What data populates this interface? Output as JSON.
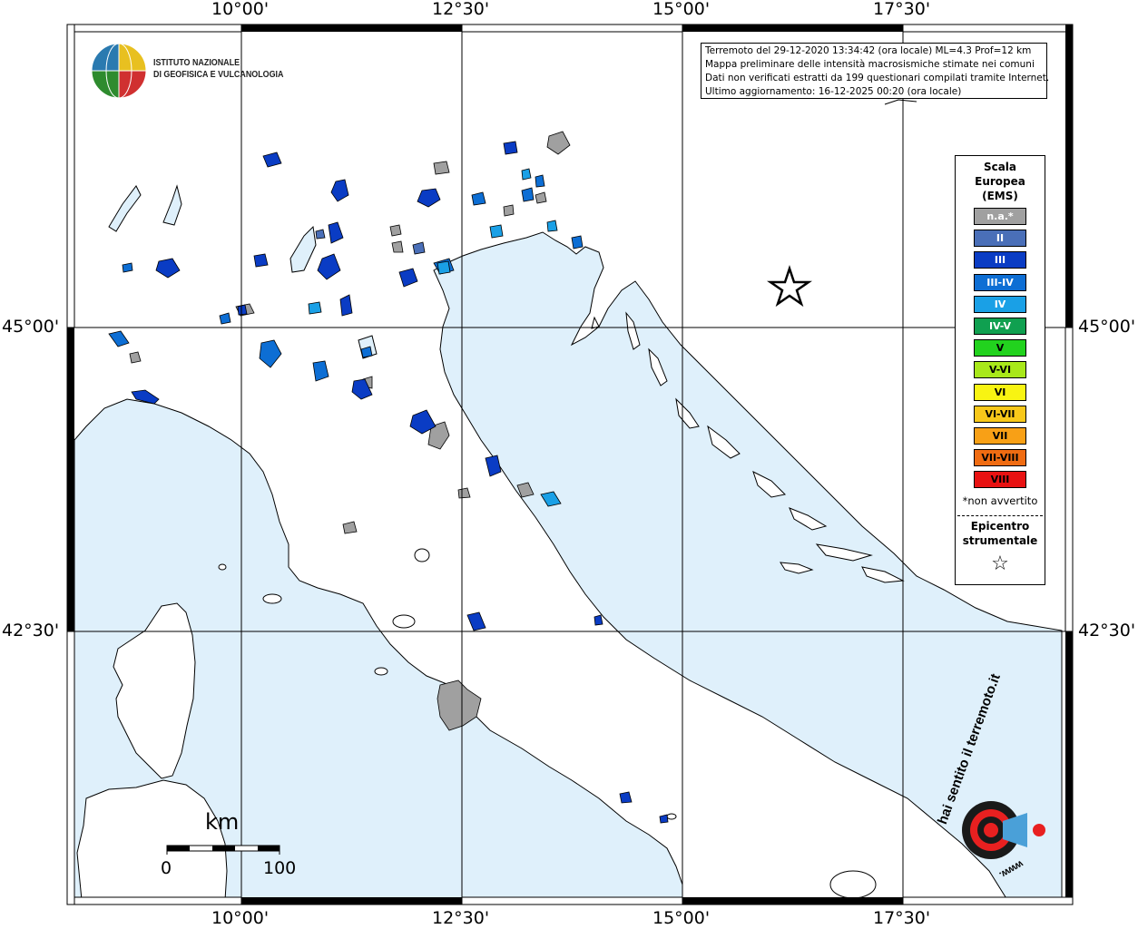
{
  "map": {
    "lon_labels": [
      "10°00'",
      "12°30'",
      "15°00'",
      "17°30'"
    ],
    "lat_labels": [
      "45°00'",
      "42°30'"
    ]
  },
  "header": {
    "org_line1": "ISTITUTO NAZIONALE",
    "org_line2": "DI GEOFISICA E VULCANOLOGIA"
  },
  "info_box": {
    "line1": "Terremoto del 29-12-2020 13:34:42 (ora locale) ML=4.3 Prof=12 km",
    "line2": "Mappa preliminare delle intensità macrosismiche stimate nei comuni",
    "line3": "Dati non verificati estratti da 199 questionari compilati tramite Internet.",
    "line4": "Ultimo aggiornamento: 16-12-2025 00:20 (ora locale)"
  },
  "legend": {
    "title_line1": "Scala",
    "title_line2": "Europea",
    "title_line3": "(EMS)",
    "items": [
      {
        "label": "n.a.*",
        "color": "#a0a0a0",
        "text_color": "#ffffff"
      },
      {
        "label": "II",
        "color": "#4a6fb8",
        "text_color": "#ffffff"
      },
      {
        "label": "III",
        "color": "#0a3cc4",
        "text_color": "#ffffff"
      },
      {
        "label": "III-IV",
        "color": "#0d6ed4",
        "text_color": "#ffffff"
      },
      {
        "label": "IV",
        "color": "#1aa0e6",
        "text_color": "#ffffff"
      },
      {
        "label": "IV-V",
        "color": "#10a050",
        "text_color": "#ffffff"
      },
      {
        "label": "V",
        "color": "#22d21e",
        "text_color": "#000000"
      },
      {
        "label": "V-VI",
        "color": "#a8e81a",
        "text_color": "#000000"
      },
      {
        "label": "VI",
        "color": "#f8f412",
        "text_color": "#000000"
      },
      {
        "label": "VI-VII",
        "color": "#f8c81a",
        "text_color": "#000000"
      },
      {
        "label": "VII",
        "color": "#f8a016",
        "text_color": "#000000"
      },
      {
        "label": "VII-VIII",
        "color": "#f06c12",
        "text_color": "#000000"
      },
      {
        "label": "VIII",
        "color": "#e81212",
        "text_color": "#000000"
      }
    ],
    "note": "*non avvertito",
    "epicenter_line1": "Epicentro",
    "epicenter_line2": "strumentale",
    "epicenter_symbol": "☆"
  },
  "scale_bar": {
    "unit": "km",
    "start": "0",
    "end": "100"
  },
  "watermark": {
    "text1": "hai sentito il terremoto.it",
    "text2": "www."
  },
  "colors": {
    "sea": "#dff0fb",
    "land": "#ffffff",
    "gray": "#a0a0a0",
    "ems_ii": "#4a6fb8",
    "ems_iii": "#0a3cc4",
    "ems_iii_iv": "#0d6ed4",
    "ems_iv": "#1aa0e6"
  }
}
